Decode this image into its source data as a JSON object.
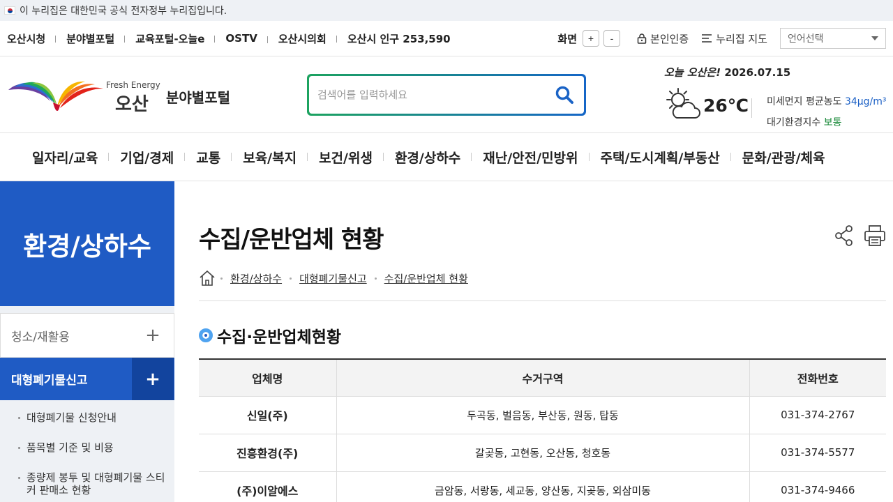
{
  "gov_banner": {
    "text": "이 누리집은 대한민국 공식 전자정부 누리집입니다."
  },
  "util": {
    "links": [
      "오산시청",
      "분야별포털",
      "교육포털-오늘e",
      "OSTV",
      "오산시의회",
      "오산시 인구 253,590"
    ],
    "zoom_label": "화면",
    "zoom_in": "+",
    "zoom_out": "-",
    "auth": "본인인증",
    "sitemap": "누리집 지도",
    "language": "언어선택"
  },
  "header": {
    "logo_en": "Fresh Energy",
    "logo_kr": "오산",
    "site_name": "분야별포털",
    "search_placeholder": "검색어를 입력하세요",
    "weather": {
      "today_label": "오늘 오산은!",
      "date": "2026.07.15",
      "temperature": "26℃",
      "dust_label": "미세먼지 평균농도",
      "dust_value": "34μg/m³",
      "air_label": "대기환경지수",
      "air_value": "보통"
    }
  },
  "gnb": [
    "일자리/교육",
    "기업/경제",
    "교통",
    "보육/복지",
    "보건/위생",
    "환경/상하수",
    "재난/안전/민방위",
    "주택/도시계획/부동산",
    "문화/관광/체육"
  ],
  "lnb": {
    "title": "환경/상하수",
    "items": [
      {
        "label": "청소/재활용",
        "active": false
      },
      {
        "label": "대형폐기물신고",
        "active": true
      }
    ],
    "subitems": [
      "대형폐기물 신청안내",
      "품목별 기준 및 비용",
      "종량제 봉투 및 대형폐기물 스티커 판매소 현황"
    ]
  },
  "main": {
    "title": "수집/운반업체 현황",
    "breadcrumb": [
      "환경/상하수",
      "대형폐기물신고",
      "수집/운반업체 현황"
    ],
    "section_title": "수집·운반업체현황",
    "table": {
      "headers": [
        "업체명",
        "수거구역",
        "전화번호"
      ],
      "rows": [
        [
          "신일(주)",
          "두곡동, 벌음동, 부산동, 원동, 탑동",
          "031-374-2767"
        ],
        [
          "진흥환경(주)",
          "갈곶동, 고현동, 오산동, 청호동",
          "031-374-5577"
        ],
        [
          "(주)이알에스",
          "금암동, 서랑동, 세교동, 양산동, 지곶동, 외삼미동",
          "031-374-9466"
        ]
      ]
    }
  }
}
